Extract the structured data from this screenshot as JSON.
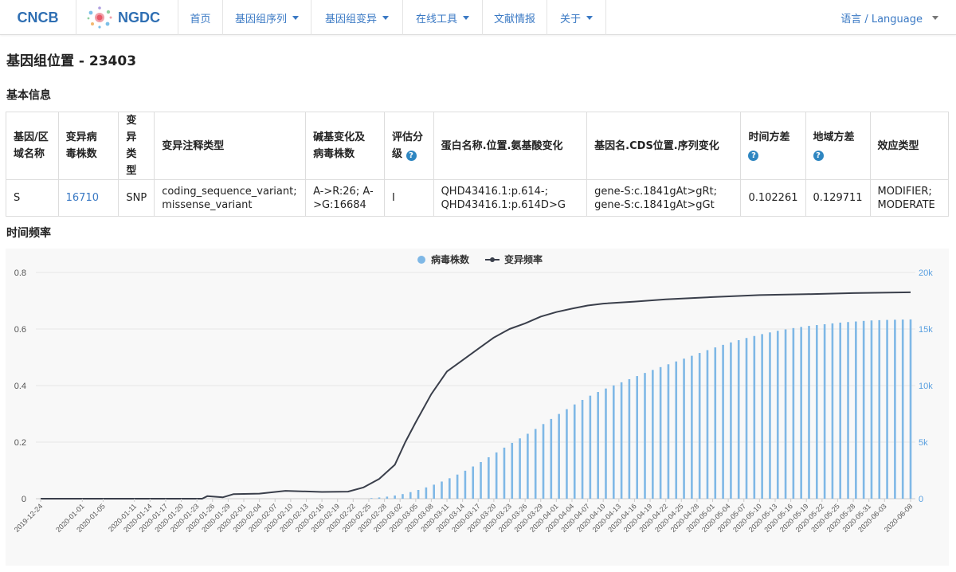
{
  "nav": {
    "brand_cncb": "CNCB",
    "brand_ngdc": "NGDC",
    "items": [
      {
        "label": "首页",
        "dropdown": false
      },
      {
        "label": "基因组序列",
        "dropdown": true
      },
      {
        "label": "基因组变异",
        "dropdown": true
      },
      {
        "label": "在线工具",
        "dropdown": true
      },
      {
        "label": "文献情报",
        "dropdown": false
      },
      {
        "label": "关于",
        "dropdown": true
      }
    ],
    "language": "语言 / Language"
  },
  "page_title": "基因组位置 - 23403",
  "basic_info": {
    "title": "基本信息",
    "headers": [
      {
        "lines": [
          "基因/区",
          "域名称"
        ],
        "help": false
      },
      {
        "lines": [
          "变异病",
          "毒株数"
        ],
        "help": false
      },
      {
        "lines": [
          "变异",
          "类型"
        ],
        "help": false
      },
      {
        "lines": [
          "变异注释类型"
        ],
        "help": false
      },
      {
        "lines": [
          "碱基变化及",
          "病毒株数"
        ],
        "help": false
      },
      {
        "lines": [
          "评估分",
          "级"
        ],
        "help": true
      },
      {
        "lines": [
          "蛋白名称.位置.氨基酸变化"
        ],
        "help": false
      },
      {
        "lines": [
          "基因名.CDS位置.序列变化"
        ],
        "help": false
      },
      {
        "lines": [
          "时间方差",
          ""
        ],
        "help": true
      },
      {
        "lines": [
          "地域方差",
          ""
        ],
        "help": true
      },
      {
        "lines": [
          "效应类型"
        ],
        "help": false
      }
    ],
    "row": [
      {
        "lines": [
          "S"
        ]
      },
      {
        "lines": [
          "16710"
        ],
        "link": true
      },
      {
        "lines": [
          "SNP"
        ]
      },
      {
        "lines": [
          "coding_sequence_variant;",
          "missense_variant"
        ]
      },
      {
        "lines": [
          "A->R:26; A-",
          ">G:16684"
        ]
      },
      {
        "lines": [
          "I"
        ]
      },
      {
        "lines": [
          "QHD43416.1:p.614-;",
          "QHD43416.1:p.614D>G"
        ]
      },
      {
        "lines": [
          "gene-S:c.1841gAt>gRt;",
          "gene-S:c.1841gAt>gGt"
        ]
      },
      {
        "lines": [
          "0.102261"
        ]
      },
      {
        "lines": [
          "0.129711"
        ]
      },
      {
        "lines": [
          "MODIFIER;",
          "MODERATE"
        ]
      }
    ]
  },
  "freq_section_title": "时间频率",
  "colors": {
    "bar": "#7fb8e6",
    "line": "#3a3f4b",
    "link": "#3a79c4",
    "right_axis": "#5aa0e0"
  },
  "chart_data": {
    "type": "bar+line",
    "legend_position": "top-center",
    "grid": true,
    "y_left": {
      "min": 0,
      "max": 0.8,
      "ticks": [
        "0",
        "0.2",
        "0.4",
        "0.6",
        "0.8"
      ]
    },
    "y_right": {
      "min": 0,
      "max": 20000,
      "ticks": [
        "0",
        "5k",
        "10k",
        "15k",
        "20k"
      ]
    },
    "x_start": "2019-12-24",
    "x_end": "2020-06-08",
    "x_tick_labels": [
      "2019-12-24",
      "2020-01-01",
      "2020-01-05",
      "2020-01-11",
      "2020-01-14",
      "2020-01-17",
      "2020-01-20",
      "2020-01-23",
      "2020-01-26",
      "2020-01-29",
      "2020-02-01",
      "2020-02-04",
      "2020-02-07",
      "2020-02-10",
      "2020-02-13",
      "2020-02-16",
      "2020-02-19",
      "2020-02-22",
      "2020-02-25",
      "2020-02-28",
      "2020-03-02",
      "2020-03-05",
      "2020-03-08",
      "2020-03-11",
      "2020-03-14",
      "2020-03-17",
      "2020-03-20",
      "2020-03-23",
      "2020-03-26",
      "2020-03-29",
      "2020-04-01",
      "2020-04-04",
      "2020-04-07",
      "2020-04-10",
      "2020-04-13",
      "2020-04-16",
      "2020-04-19",
      "2020-04-22",
      "2020-04-25",
      "2020-04-28",
      "2020-05-01",
      "2020-05-04",
      "2020-05-07",
      "2020-05-10",
      "2020-05-13",
      "2020-05-16",
      "2020-05-19",
      "2020-05-22",
      "2020-05-25",
      "2020-05-28",
      "2020-05-31",
      "2020-06-03",
      "2020-06-08"
    ],
    "series": [
      {
        "name": "病毒株数",
        "type": "bar",
        "axis": "right",
        "points": [
          {
            "x": "2020-02-24",
            "y": 0
          },
          {
            "x": "2020-02-28",
            "y": 150
          },
          {
            "x": "2020-03-02",
            "y": 350
          },
          {
            "x": "2020-03-05",
            "y": 700
          },
          {
            "x": "2020-03-08",
            "y": 1150
          },
          {
            "x": "2020-03-11",
            "y": 1700
          },
          {
            "x": "2020-03-14",
            "y": 2350
          },
          {
            "x": "2020-03-17",
            "y": 3100
          },
          {
            "x": "2020-03-20",
            "y": 3950
          },
          {
            "x": "2020-03-23",
            "y": 4800
          },
          {
            "x": "2020-03-26",
            "y": 5600
          },
          {
            "x": "2020-03-29",
            "y": 6450
          },
          {
            "x": "2020-04-01",
            "y": 7350
          },
          {
            "x": "2020-04-04",
            "y": 8200
          },
          {
            "x": "2020-04-07",
            "y": 9000
          },
          {
            "x": "2020-04-10",
            "y": 9650
          },
          {
            "x": "2020-04-13",
            "y": 10200
          },
          {
            "x": "2020-04-16",
            "y": 10750
          },
          {
            "x": "2020-04-19",
            "y": 11300
          },
          {
            "x": "2020-04-22",
            "y": 11800
          },
          {
            "x": "2020-04-25",
            "y": 12300
          },
          {
            "x": "2020-04-28",
            "y": 12800
          },
          {
            "x": "2020-05-01",
            "y": 13300
          },
          {
            "x": "2020-05-04",
            "y": 13750
          },
          {
            "x": "2020-05-07",
            "y": 14150
          },
          {
            "x": "2020-05-10",
            "y": 14500
          },
          {
            "x": "2020-05-13",
            "y": 14800
          },
          {
            "x": "2020-05-16",
            "y": 15050
          },
          {
            "x": "2020-05-19",
            "y": 15250
          },
          {
            "x": "2020-05-22",
            "y": 15400
          },
          {
            "x": "2020-05-25",
            "y": 15550
          },
          {
            "x": "2020-05-28",
            "y": 15650
          },
          {
            "x": "2020-05-31",
            "y": 15750
          },
          {
            "x": "2020-06-03",
            "y": 15800
          },
          {
            "x": "2020-06-08",
            "y": 15850
          }
        ]
      },
      {
        "name": "变异频率",
        "type": "line",
        "axis": "left",
        "points": [
          {
            "x": "2019-12-24",
            "y": 0
          },
          {
            "x": "2020-01-24",
            "y": 0
          },
          {
            "x": "2020-01-25",
            "y": 0.009
          },
          {
            "x": "2020-01-28",
            "y": 0.005
          },
          {
            "x": "2020-01-30",
            "y": 0.016
          },
          {
            "x": "2020-02-04",
            "y": 0.018
          },
          {
            "x": "2020-02-09",
            "y": 0.028
          },
          {
            "x": "2020-02-16",
            "y": 0.024
          },
          {
            "x": "2020-02-21",
            "y": 0.025
          },
          {
            "x": "2020-02-24",
            "y": 0.04
          },
          {
            "x": "2020-02-27",
            "y": 0.07
          },
          {
            "x": "2020-03-01",
            "y": 0.12
          },
          {
            "x": "2020-03-03",
            "y": 0.2
          },
          {
            "x": "2020-03-05",
            "y": 0.27
          },
          {
            "x": "2020-03-08",
            "y": 0.37
          },
          {
            "x": "2020-03-11",
            "y": 0.45
          },
          {
            "x": "2020-03-14",
            "y": 0.49
          },
          {
            "x": "2020-03-17",
            "y": 0.53
          },
          {
            "x": "2020-03-20",
            "y": 0.57
          },
          {
            "x": "2020-03-23",
            "y": 0.6
          },
          {
            "x": "2020-03-26",
            "y": 0.62
          },
          {
            "x": "2020-03-29",
            "y": 0.644
          },
          {
            "x": "2020-04-01",
            "y": 0.66
          },
          {
            "x": "2020-04-04",
            "y": 0.672
          },
          {
            "x": "2020-04-07",
            "y": 0.683
          },
          {
            "x": "2020-04-10",
            "y": 0.69
          },
          {
            "x": "2020-04-16",
            "y": 0.697
          },
          {
            "x": "2020-04-22",
            "y": 0.705
          },
          {
            "x": "2020-05-01",
            "y": 0.713
          },
          {
            "x": "2020-05-10",
            "y": 0.72
          },
          {
            "x": "2020-05-19",
            "y": 0.723
          },
          {
            "x": "2020-05-28",
            "y": 0.727
          },
          {
            "x": "2020-06-08",
            "y": 0.73
          }
        ]
      }
    ]
  }
}
